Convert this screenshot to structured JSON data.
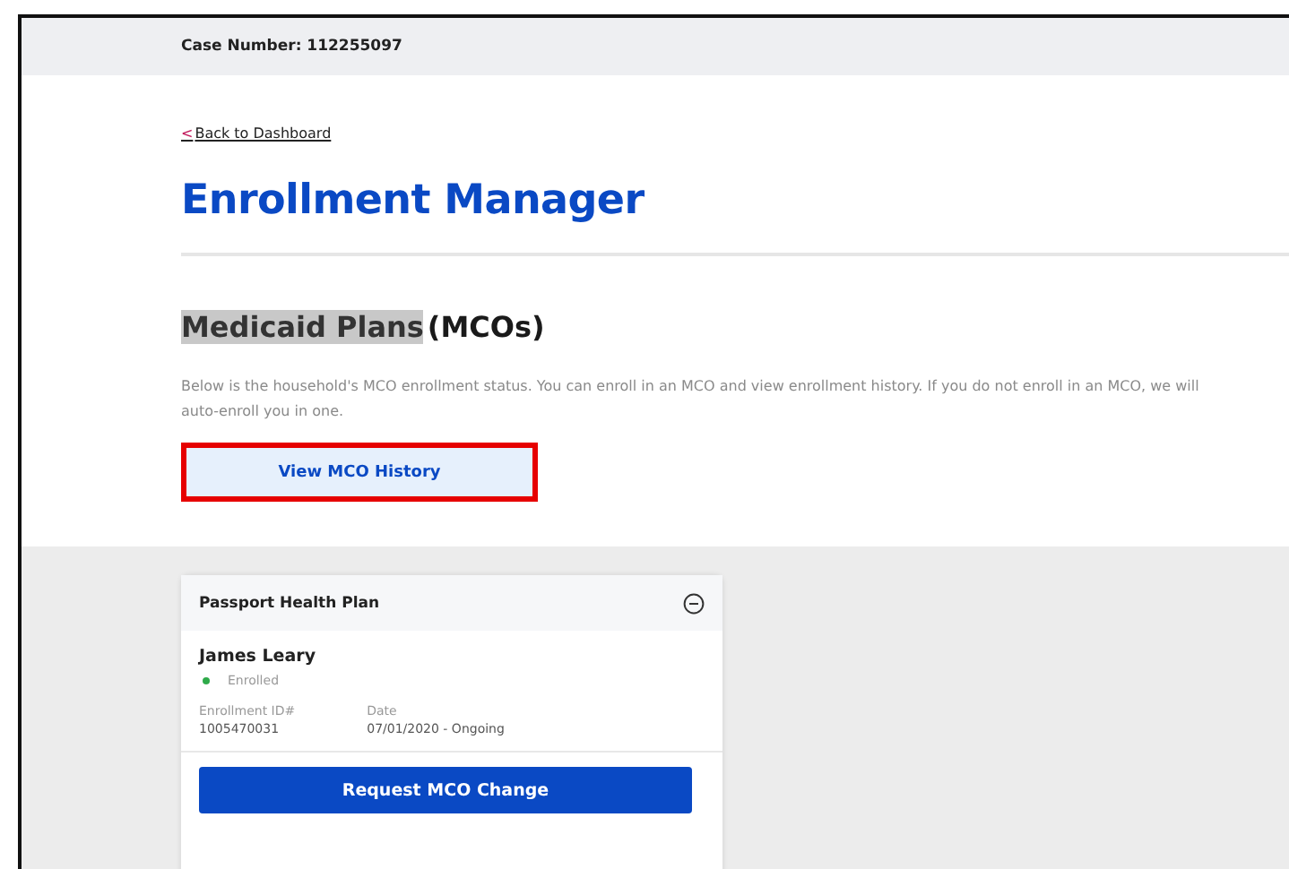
{
  "header": {
    "case_number": "Case Number: 112255097"
  },
  "back_link": {
    "arrow": "<",
    "label": "Back to Dashboard"
  },
  "title": "Enrollment Manager",
  "section": {
    "title_highlighted": "Medicaid Plans",
    "title_rest": "(MCOs)",
    "description": "Below is the household's MCO enrollment status. You can enroll in an MCO and view enrollment history. If you do not enroll in an MCO, we will auto-enroll you in one.",
    "history_button": {
      "label": "View MCO History",
      "annotated": true
    }
  },
  "plan_card": {
    "plan_name": "Passport Health Plan",
    "expanded": true,
    "member": {
      "name": "James Leary",
      "status": "Enrolled",
      "color": "#2eaa4a"
    },
    "fields": [
      {
        "label": "Enrollment ID#",
        "value": "1005470031"
      },
      {
        "label": "Date",
        "value": "07/01/2020 - Ongoing"
      }
    ],
    "action_button": "Request MCO Change"
  }
}
